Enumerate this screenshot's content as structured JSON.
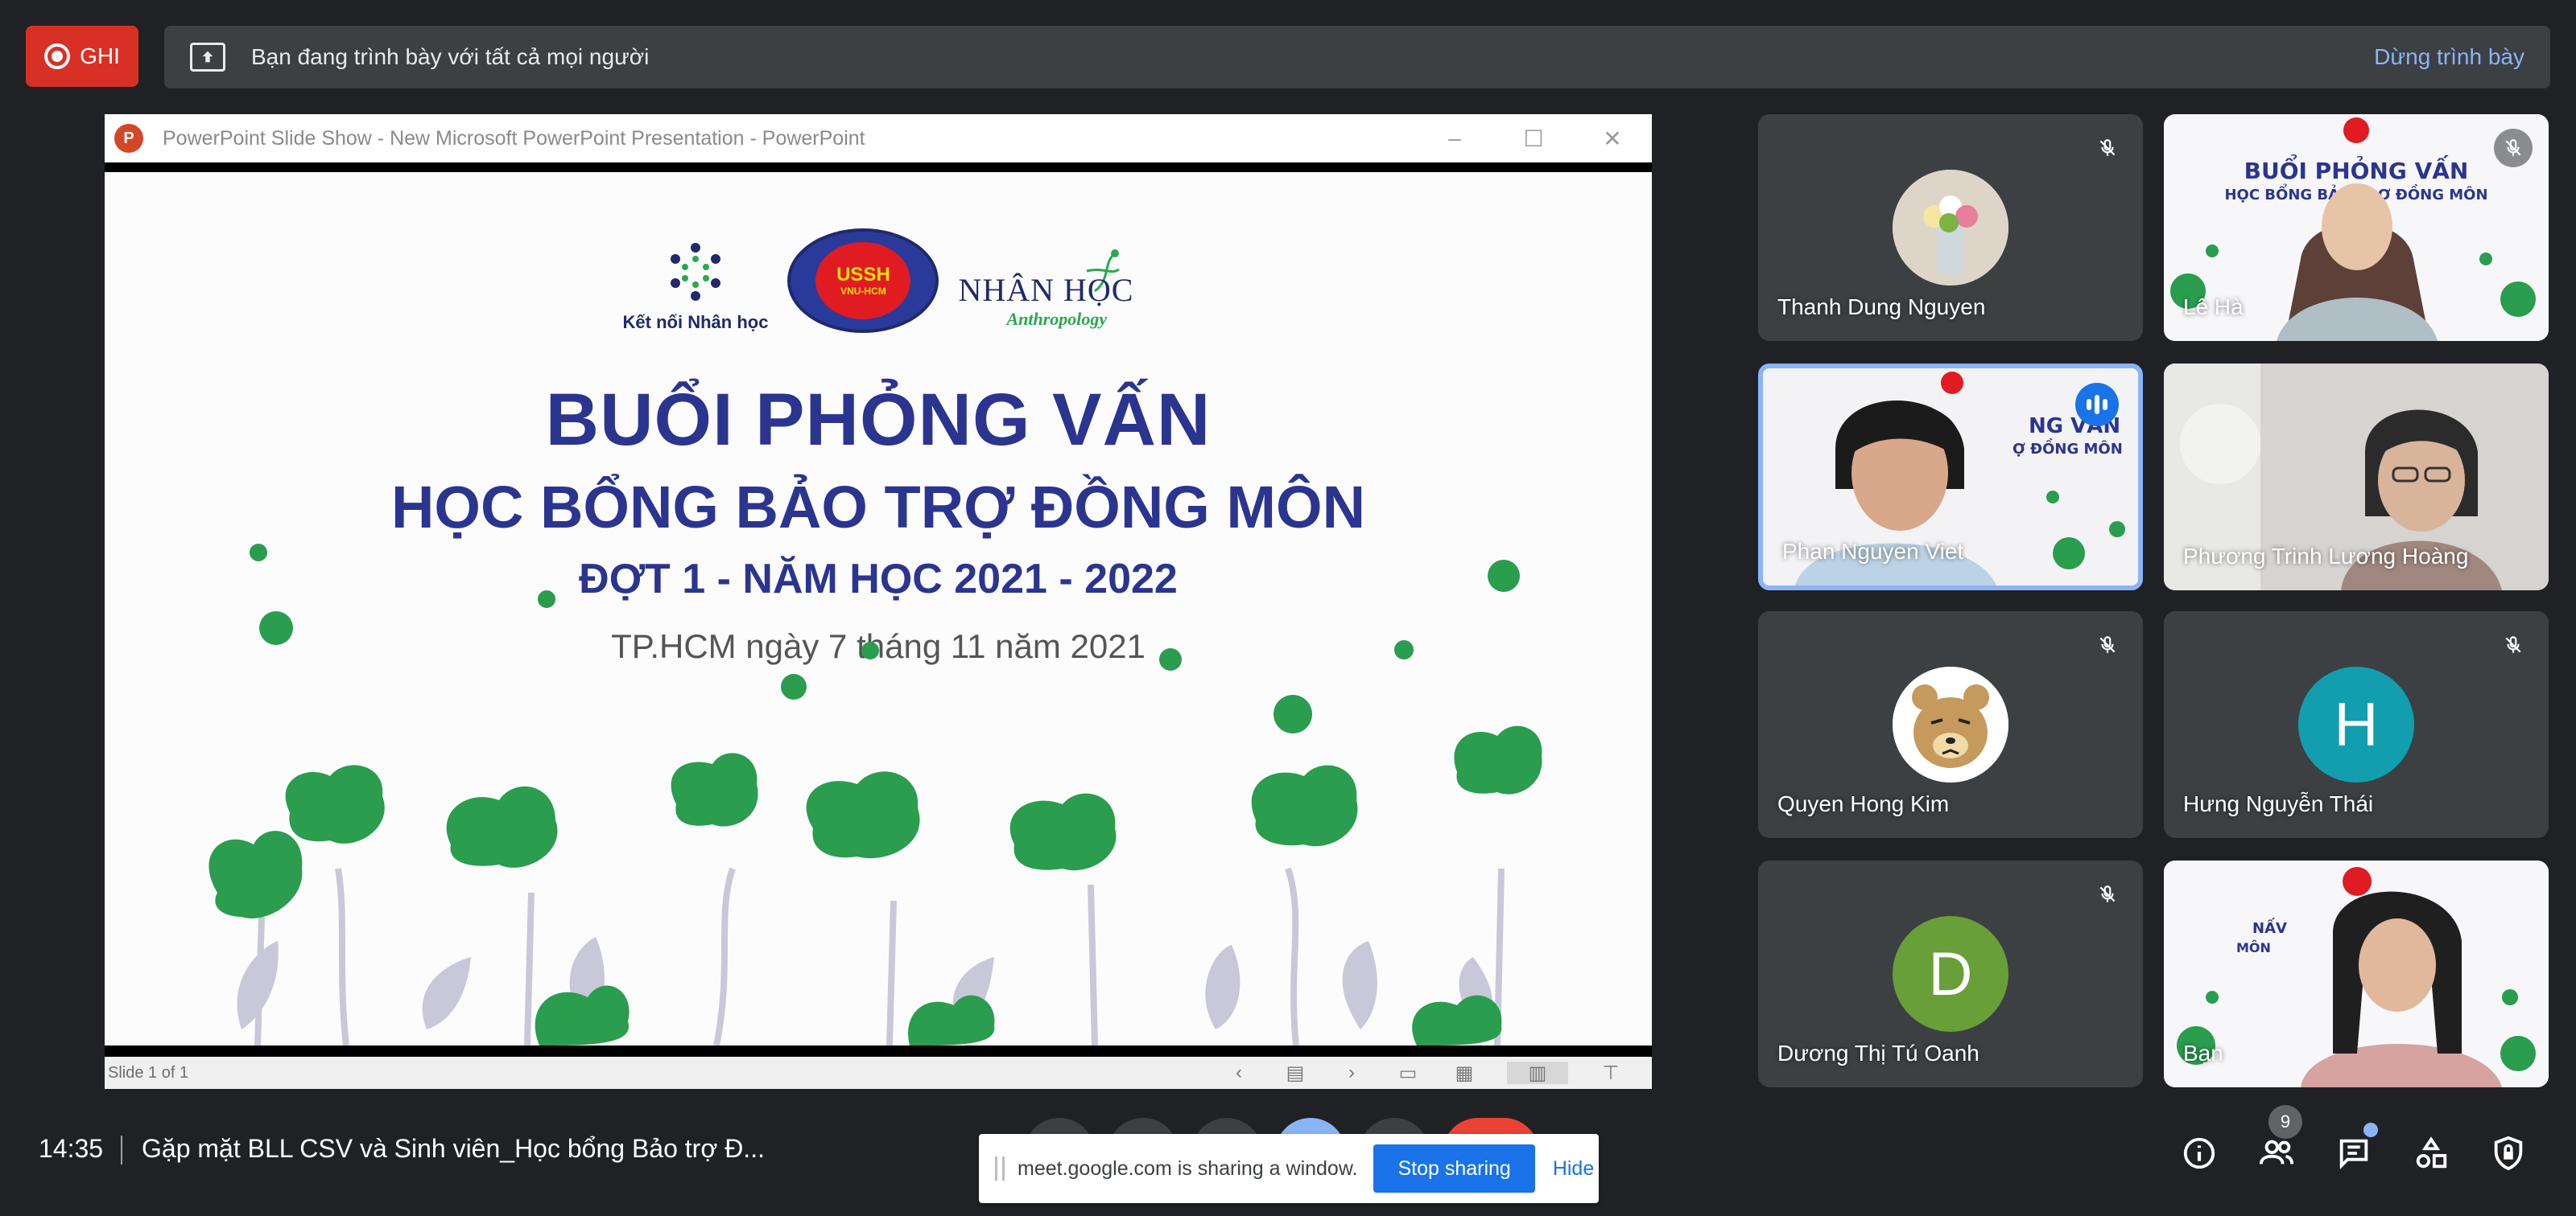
{
  "topbar": {
    "rec_label": "GHI",
    "presenting_text": "Bạn đang trình bày với tất cả mọi người",
    "stop_presenting": "Dừng trình bày"
  },
  "window": {
    "title": "PowerPoint Slide Show  -  New Microsoft PowerPoint Presentation - PowerPoint",
    "logo_letter": "P",
    "status": "Slide 1 of 1"
  },
  "slide": {
    "logo_ketnoi": "Kết nối Nhân học",
    "logo_ussh": "USSH",
    "logo_ussh_sub": "VNU-HCM",
    "logo_nhanhoc": "NHÂN HỌC",
    "logo_anthropology": "Anthropology",
    "title1": "BUỔI PHỎNG VẤN",
    "title2": "HỌC BỔNG BẢO TRỢ ĐỒNG MÔN",
    "title3": "ĐỢT 1 - NĂM HỌC 2021 - 2022",
    "title4": "TP.HCM ngày 7 tháng 11 năm 2021"
  },
  "participants": [
    {
      "name": "Thanh Dung Nguyen",
      "muted": true
    },
    {
      "name": "Lê Hà",
      "muted": true
    },
    {
      "name": "Phan Nguyen Viet",
      "muted": false,
      "speaking": true
    },
    {
      "name": "Phương Trinh Lương Hoàng",
      "muted": false
    },
    {
      "name": "Quyen Hong Kim",
      "muted": true
    },
    {
      "name": "Hưng Nguyễn Thái",
      "muted": true,
      "initial": "H",
      "color": "#129eaf"
    },
    {
      "name": "Dương Thị Tú Oanh",
      "muted": true,
      "initial": "D",
      "color": "#689f38"
    },
    {
      "name": "Bạn",
      "muted": false
    }
  ],
  "bottombar": {
    "time": "14:35",
    "meeting_title": "Gặp mặt BLL CSV và Sinh viên_Học bổng Bảo trợ Đ...",
    "share_notice": "meet.google.com is sharing a window.",
    "stop_sharing": "Stop sharing",
    "hide": "Hide",
    "people_count": "9"
  },
  "colors": {
    "record": "#d93025",
    "accent": "#8ab4f8",
    "button_blue": "#1a73e8",
    "slide_title": "#2b3590",
    "leaf_green": "#2a9d4e"
  },
  "icons": [
    "present-to-all-icon",
    "mic-off-icon",
    "info-icon",
    "people-icon",
    "chat-icon",
    "activities-icon",
    "host-controls-icon"
  ]
}
